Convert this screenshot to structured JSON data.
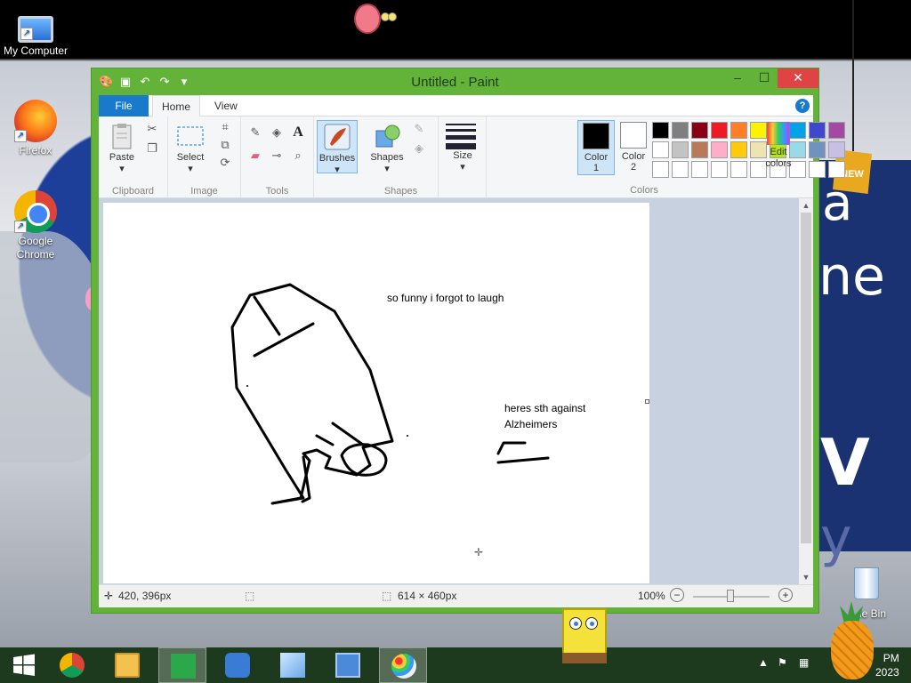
{
  "desktop": {
    "icons": [
      {
        "label": "My Computer"
      },
      {
        "label": "Firefox"
      },
      {
        "label": "Google Chrome"
      }
    ],
    "recycle_bin_label": "le Bin",
    "wallpaper_text": {
      "a": "a",
      "ne": "ne",
      "v": "V",
      "y": "y"
    },
    "new_badge": "NEW"
  },
  "window": {
    "title": "Untitled - Paint",
    "controls": {
      "minimize": "‒",
      "maximize": "☐",
      "close": "✕"
    }
  },
  "tabs": {
    "file": "File",
    "home": "Home",
    "view": "View"
  },
  "ribbon": {
    "clipboard": {
      "label": "Clipboard",
      "paste": "Paste"
    },
    "image": {
      "label": "Image",
      "select": "Select"
    },
    "tools": {
      "label": "Tools"
    },
    "brushes": {
      "label": "Brushes"
    },
    "shapes": {
      "label": "Shapes",
      "button": "Shapes"
    },
    "size": {
      "label": "Size"
    },
    "colors": {
      "label": "Colors",
      "color1": "Color",
      "color1_num": "1",
      "color2": "Color",
      "color2_num": "2",
      "edit": "Edit",
      "edit2": "colors",
      "row1": [
        "#000000",
        "#7f7f7f",
        "#880015",
        "#ed1c24",
        "#ff7f27",
        "#fff200",
        "#22b14c",
        "#00a2e8",
        "#3f48cc",
        "#a349a4"
      ],
      "row2": [
        "#ffffff",
        "#c3c3c3",
        "#b97a57",
        "#ffaec9",
        "#ffc90e",
        "#efe4b0",
        "#b5e61d",
        "#99d9ea",
        "#7092be",
        "#c8bfe7"
      ],
      "row3": [
        "#ffffff",
        "#ffffff",
        "#ffffff",
        "#ffffff",
        "#ffffff",
        "#ffffff",
        "#ffffff",
        "#ffffff",
        "#ffffff",
        "#ffffff"
      ],
      "primary": "#000000",
      "secondary": "#ffffff"
    }
  },
  "canvas": {
    "text1": "so funny i forgot to laugh",
    "text2_line1": "heres sth against",
    "text2_line2": "Alzheimers"
  },
  "status": {
    "cursor": "420, 396px",
    "size": "614 × 460px",
    "zoom": "100%"
  },
  "taskbar": {
    "clock_time": "PM",
    "clock_date": "2023"
  }
}
